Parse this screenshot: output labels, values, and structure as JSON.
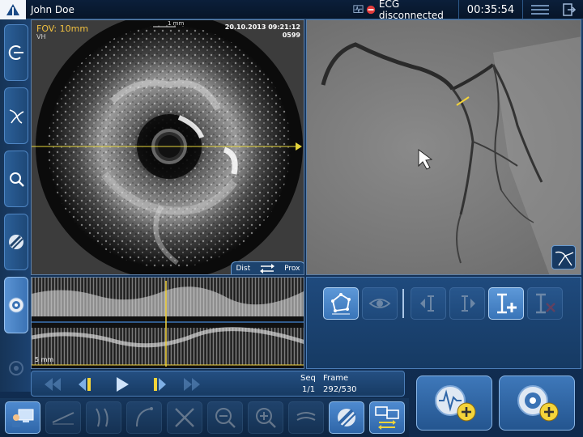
{
  "topbar": {
    "patient_name": "John Doe",
    "ecg_status": "ECG disconnected",
    "timer": "00:35:54"
  },
  "ivus": {
    "fov": "FOV: 10mm",
    "mode": "VH",
    "datetime": "20.10.2013 09:21:12",
    "frame_id": "0599",
    "scale_label": "1 mm",
    "dist_label": "Dist",
    "prox_label": "Prox"
  },
  "longview": {
    "scale_label": "5 mm"
  },
  "playback": {
    "seq_label": "Seq",
    "frame_label": "Frame",
    "seq_value": "1/1",
    "frame_value": "292/530"
  },
  "left_tools": [
    {
      "name": "pullback-tool",
      "icon": "catheter-icon"
    },
    {
      "name": "angio-tool",
      "icon": "vessel-tree-icon"
    },
    {
      "name": "measure-tool",
      "icon": "magnifier-icon"
    },
    {
      "name": "vh-tool",
      "icon": "plaque-icon"
    },
    {
      "name": "ivus-view-tool",
      "icon": "ivus-cross-section-icon",
      "active": true
    },
    {
      "name": "disabled-tool",
      "icon": "gear-icon",
      "disabled": true
    }
  ],
  "colors": {
    "accent": "#3b73b5",
    "fov_text": "#f0c040",
    "marker": "#f4d43a",
    "ecg_alert": "#e23b3b"
  }
}
